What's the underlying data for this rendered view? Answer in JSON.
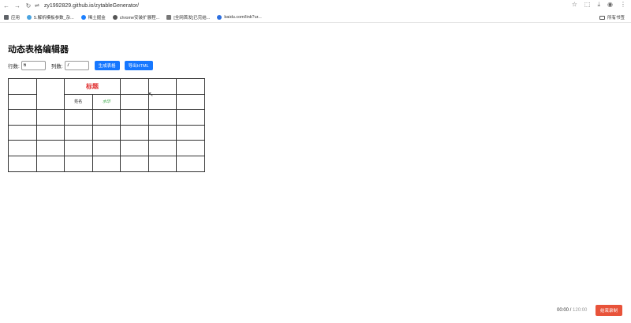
{
  "browser": {
    "url": "zy1992829.github.io/zytableGenerator/",
    "bookmarks": [
      {
        "label": "应用",
        "color": "#5f6368"
      },
      {
        "label": "5.解析模板参数_杂...",
        "color": "#4aa3df"
      },
      {
        "label": "稀土掘金",
        "color": "#1e80ff"
      },
      {
        "label": "chrome安装扩展程...",
        "color": "#555555"
      },
      {
        "label": "[全网首发]已完结...",
        "color": "#777777"
      },
      {
        "label": "baidu.com/link?ur...",
        "color": "#2d6fe0"
      }
    ],
    "all_bookmarks": "所有书签"
  },
  "page": {
    "title": "动态表格编辑器",
    "rows_label": "行数:",
    "rows_value": "6",
    "cols_label": "列数:",
    "cols_value": "7",
    "generate_button": "生成表格",
    "export_button": "导出HTML"
  },
  "table": {
    "merged_title": "标题",
    "name_cell": "姓名",
    "green_cell": "水印"
  },
  "recorder": {
    "elapsed": "00:00",
    "separator": " / ",
    "total": "120:00",
    "end_button": "结束录制"
  }
}
